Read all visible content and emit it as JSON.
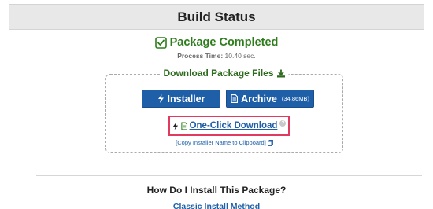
{
  "header": {
    "title": "Build Status"
  },
  "status": {
    "text": "Package Completed",
    "process_time_label": "Process Time:",
    "process_time_value": "10.40 sec."
  },
  "download": {
    "title": "Download Package Files",
    "installer_label": "Installer",
    "archive_label": "Archive",
    "archive_size": "(34.86MB)",
    "one_click_label": "One-Click Download",
    "copy_link": "[Copy Installer Name to Clipboard]"
  },
  "install": {
    "question": "How Do I Install This Package?",
    "classic_link": "Classic Install Method"
  },
  "colors": {
    "success": "#2e7d1d",
    "button": "#1f5fa8",
    "highlight": "#e03a5e"
  },
  "icons": {
    "status": "check-square-icon",
    "download_title": "download-arrow-icon",
    "installer": "bolt-icon",
    "archive": "file-icon",
    "one_click": [
      "bolt-icon",
      "file-icon"
    ],
    "help": "help-icon",
    "copy": "copy-icon"
  }
}
